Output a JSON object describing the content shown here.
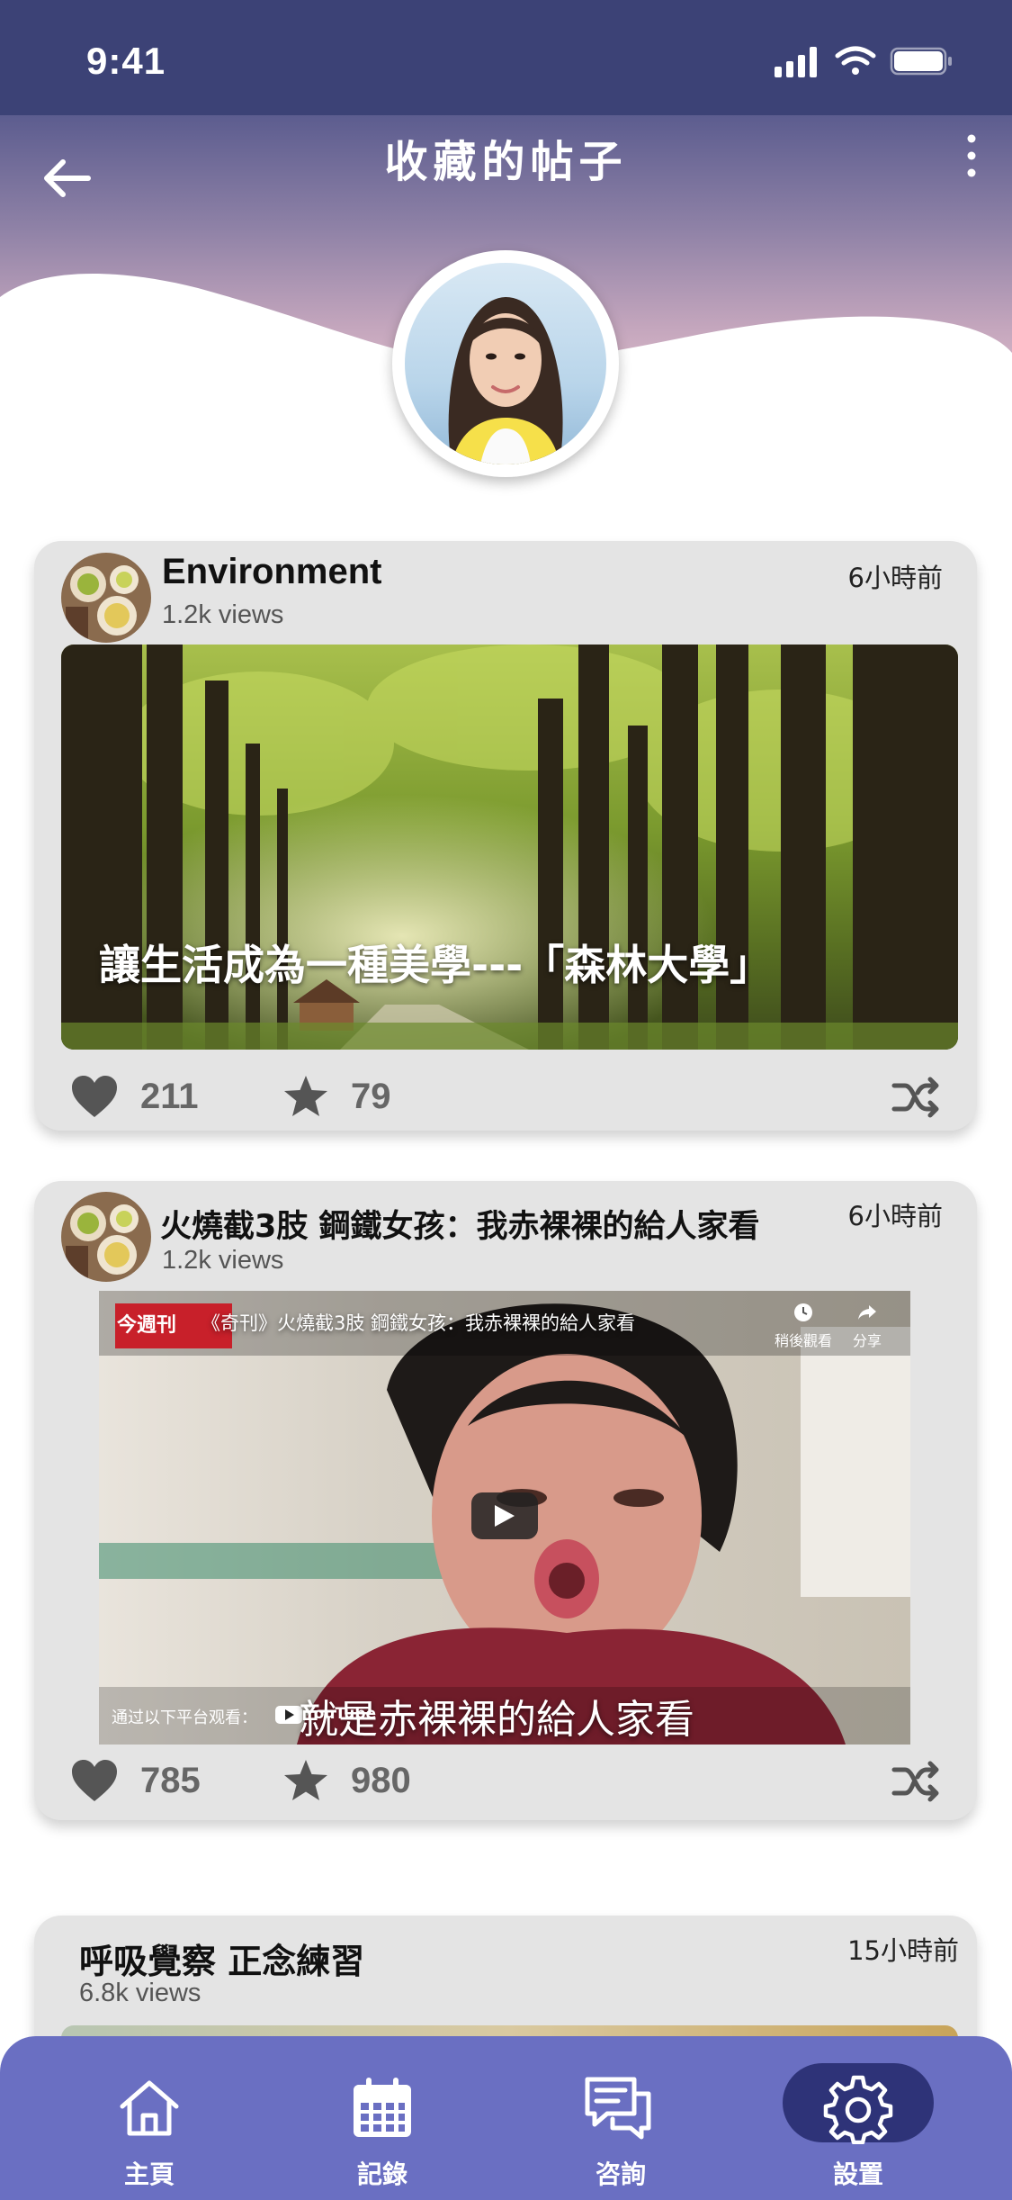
{
  "status_bar": {
    "time": "9:41"
  },
  "header": {
    "title": "收藏的帖子"
  },
  "posts": [
    {
      "title": "Environment",
      "views": "1.2k views",
      "time": "6小時前",
      "image_caption": "讓生活成為一種美學---「森林大學」",
      "likes": "211",
      "favorites": "79"
    },
    {
      "title": "火燒截3肢 鋼鐵女孩：我赤裸裸的給人家看",
      "views": "1.2k views",
      "time": "6小時前",
      "video": {
        "channel_badge": "今週刊",
        "title": "《奇刊》火燒截3肢 鋼鐵女孩：我赤裸裸的給人家看",
        "watch_later": "稍後觀看",
        "share": "分享",
        "platform_text": "通过以下平台观看：",
        "platform_name": "YouTube",
        "subtitle": "就是赤裸裸的給人家看"
      },
      "likes": "785",
      "favorites": "980"
    },
    {
      "title": "呼吸覺察 正念練習",
      "views": "6.8k views",
      "time": "15小時前"
    }
  ],
  "nav": {
    "items": [
      {
        "label": "主頁",
        "icon": "home-icon"
      },
      {
        "label": "記錄",
        "icon": "calendar-icon"
      },
      {
        "label": "咨詢",
        "icon": "chat-icon"
      },
      {
        "label": "設置",
        "icon": "gear-icon"
      }
    ],
    "active_index": 3
  },
  "colors": {
    "status_bar": "#3c4276",
    "header_gradient_end": "#e2c1cd",
    "card_bg": "#e4e4e4",
    "nav_bg": "#6a6fc2",
    "nav_active": "#2e3378",
    "icon_gray": "#555555"
  }
}
